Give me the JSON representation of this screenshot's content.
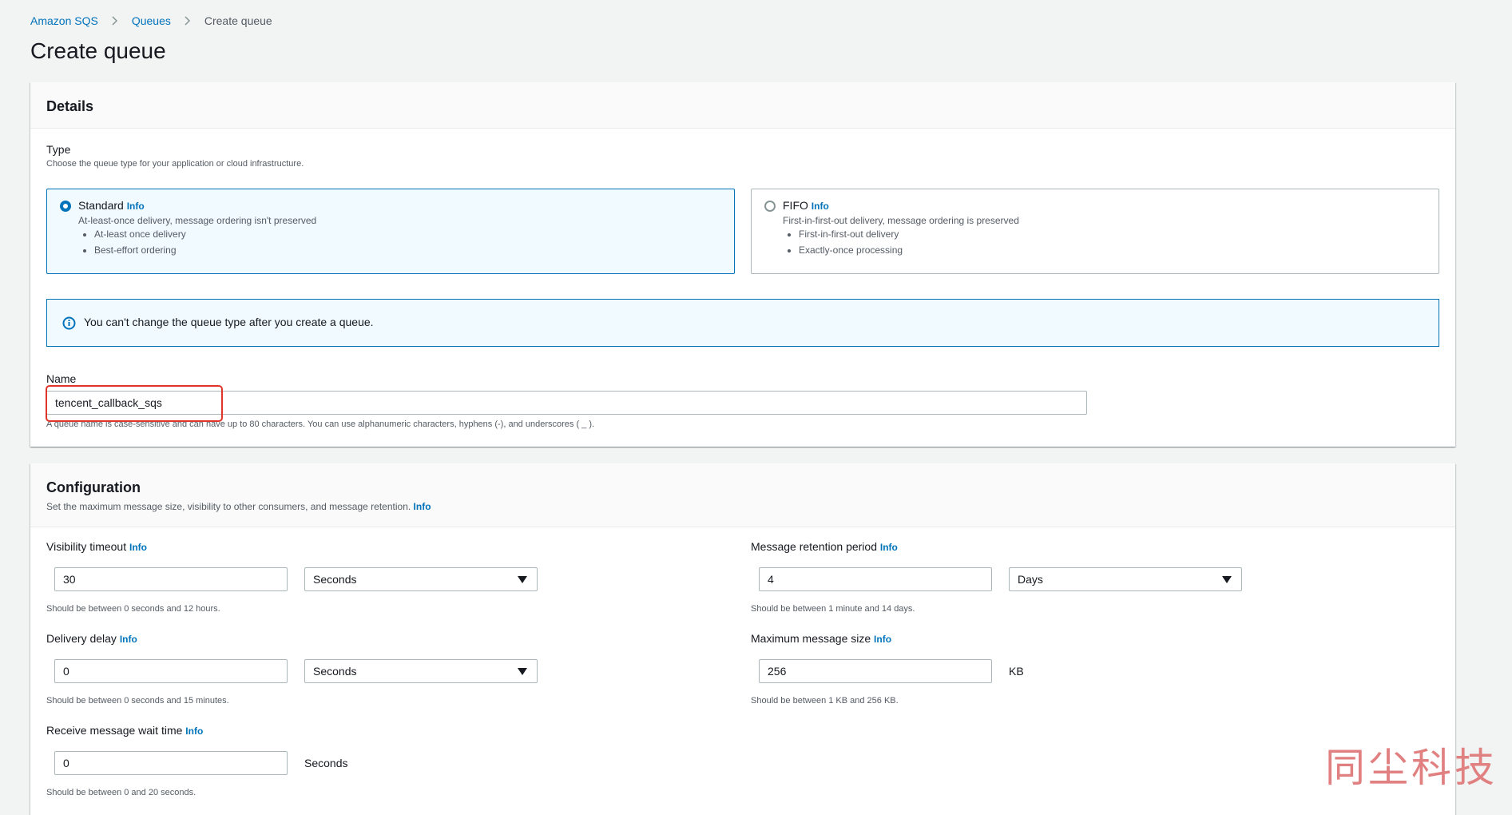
{
  "breadcrumb": {
    "root": "Amazon SQS",
    "queues": "Queues",
    "current": "Create queue"
  },
  "page_title": "Create queue",
  "details": {
    "title": "Details",
    "type_label": "Type",
    "type_desc": "Choose the queue type for your application or cloud infrastructure.",
    "standard": {
      "title": "Standard",
      "info": "Info",
      "sub": "At-least-once delivery, message ordering isn't preserved",
      "bullets": [
        "At-least once delivery",
        "Best-effort ordering"
      ],
      "selected": true
    },
    "fifo": {
      "title": "FIFO",
      "info": "Info",
      "sub": "First-in-first-out delivery, message ordering is preserved",
      "bullets": [
        "First-in-first-out delivery",
        "Exactly-once processing"
      ],
      "selected": false
    },
    "alert": "You can't change the queue type after you create a queue.",
    "name_label": "Name",
    "name_value": "tencent_callback_sqs",
    "name_hint": "A queue name is case-sensitive and can have up to 80 characters. You can use alphanumeric characters, hyphens (-), and underscores ( _ )."
  },
  "configuration": {
    "title": "Configuration",
    "desc": "Set the maximum message size, visibility to other consumers, and message retention.",
    "info": "Info",
    "visibility_timeout": {
      "label": "Visibility timeout",
      "info": "Info",
      "value": "30",
      "unit": "Seconds",
      "hint": "Should be between 0 seconds and 12 hours."
    },
    "retention_period": {
      "label": "Message retention period",
      "info": "Info",
      "value": "4",
      "unit": "Days",
      "hint": "Should be between 1 minute and 14 days."
    },
    "delivery_delay": {
      "label": "Delivery delay",
      "info": "Info",
      "value": "0",
      "unit": "Seconds",
      "hint": "Should be between 0 seconds and 15 minutes."
    },
    "max_message_size": {
      "label": "Maximum message size",
      "info": "Info",
      "value": "256",
      "unit": "KB",
      "hint": "Should be between 1 KB and 256 KB."
    },
    "receive_wait_time": {
      "label": "Receive message wait time",
      "info": "Info",
      "value": "0",
      "unit": "Seconds",
      "hint": "Should be between 0 and 20 seconds."
    }
  },
  "watermark": "同尘科技",
  "colors": {
    "link": "#0073bb",
    "highlight": "#e0342b",
    "selected_bg": "#f1faff"
  }
}
